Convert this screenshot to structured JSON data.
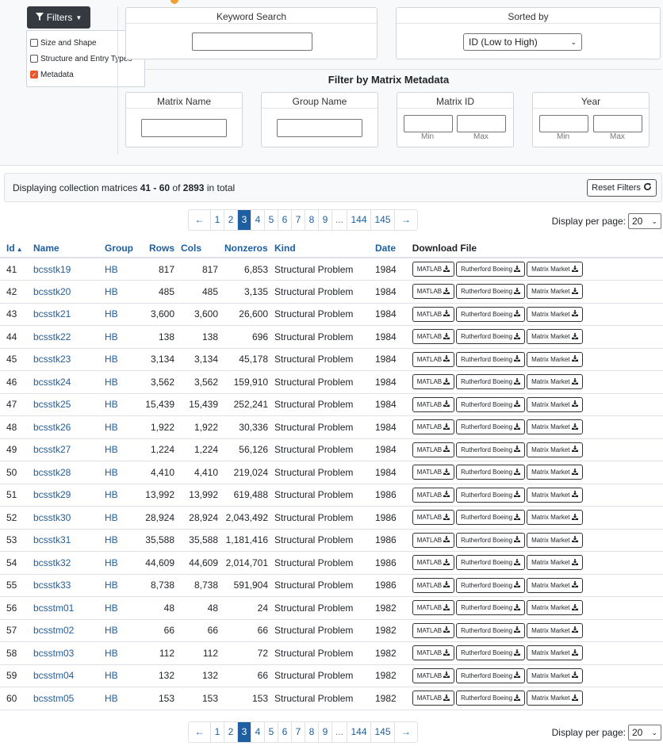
{
  "filters": {
    "button_label": "Filters",
    "menu": [
      {
        "label": "Size and Shape",
        "checked": false
      },
      {
        "label": "Structure and Entry Types",
        "checked": false
      },
      {
        "label": "Metadata",
        "checked": true
      }
    ]
  },
  "keyword_search": {
    "title": "Keyword Search",
    "value": ""
  },
  "sorted_by": {
    "title": "Sorted by",
    "selected": "ID (Low to High)"
  },
  "metadata_filter": {
    "title": "Filter by Matrix Metadata",
    "matrix_name": {
      "title": "Matrix Name",
      "value": ""
    },
    "group_name": {
      "title": "Group Name",
      "value": ""
    },
    "matrix_id": {
      "title": "Matrix ID",
      "min_label": "Min",
      "max_label": "Max"
    },
    "year": {
      "title": "Year",
      "min_label": "Min",
      "max_label": "Max"
    }
  },
  "display": {
    "prefix": "Displaying collection matrices ",
    "range": "41 - 60",
    "middle": " of ",
    "total": "2893",
    "suffix": " in total",
    "reset_label": "Reset Filters"
  },
  "pagination": {
    "pages": [
      "←",
      "1",
      "2",
      "3",
      "4",
      "5",
      "6",
      "7",
      "8",
      "9",
      "...",
      "144",
      "145",
      "→"
    ],
    "active": "3",
    "per_page_label": "Display per page:",
    "per_page": "20"
  },
  "table": {
    "headers": [
      "Id",
      "Name",
      "Group",
      "Rows",
      "Cols",
      "Nonzeros",
      "Kind",
      "Date",
      "Download File"
    ],
    "sort_indicator": "▲",
    "download_labels": [
      "MATLAB",
      "Rutherford Boeing",
      "Matrix Market"
    ],
    "rows": [
      [
        "41",
        "bcsstk19",
        "HB",
        "817",
        "817",
        "6,853",
        "Structural Problem",
        "1984"
      ],
      [
        "42",
        "bcsstk20",
        "HB",
        "485",
        "485",
        "3,135",
        "Structural Problem",
        "1984"
      ],
      [
        "43",
        "bcsstk21",
        "HB",
        "3,600",
        "3,600",
        "26,600",
        "Structural Problem",
        "1984"
      ],
      [
        "44",
        "bcsstk22",
        "HB",
        "138",
        "138",
        "696",
        "Structural Problem",
        "1984"
      ],
      [
        "45",
        "bcsstk23",
        "HB",
        "3,134",
        "3,134",
        "45,178",
        "Structural Problem",
        "1984"
      ],
      [
        "46",
        "bcsstk24",
        "HB",
        "3,562",
        "3,562",
        "159,910",
        "Structural Problem",
        "1984"
      ],
      [
        "47",
        "bcsstk25",
        "HB",
        "15,439",
        "15,439",
        "252,241",
        "Structural Problem",
        "1984"
      ],
      [
        "48",
        "bcsstk26",
        "HB",
        "1,922",
        "1,922",
        "30,336",
        "Structural Problem",
        "1984"
      ],
      [
        "49",
        "bcsstk27",
        "HB",
        "1,224",
        "1,224",
        "56,126",
        "Structural Problem",
        "1984"
      ],
      [
        "50",
        "bcsstk28",
        "HB",
        "4,410",
        "4,410",
        "219,024",
        "Structural Problem",
        "1984"
      ],
      [
        "51",
        "bcsstk29",
        "HB",
        "13,992",
        "13,992",
        "619,488",
        "Structural Problem",
        "1986"
      ],
      [
        "52",
        "bcsstk30",
        "HB",
        "28,924",
        "28,924",
        "2,043,492",
        "Structural Problem",
        "1986"
      ],
      [
        "53",
        "bcsstk31",
        "HB",
        "35,588",
        "35,588",
        "1,181,416",
        "Structural Problem",
        "1986"
      ],
      [
        "54",
        "bcsstk32",
        "HB",
        "44,609",
        "44,609",
        "2,014,701",
        "Structural Problem",
        "1986"
      ],
      [
        "55",
        "bcsstk33",
        "HB",
        "8,738",
        "8,738",
        "591,904",
        "Structural Problem",
        "1986"
      ],
      [
        "56",
        "bcsstm01",
        "HB",
        "48",
        "48",
        "24",
        "Structural Problem",
        "1982"
      ],
      [
        "57",
        "bcsstm02",
        "HB",
        "66",
        "66",
        "66",
        "Structural Problem",
        "1982"
      ],
      [
        "58",
        "bcsstm03",
        "HB",
        "112",
        "112",
        "72",
        "Structural Problem",
        "1982"
      ],
      [
        "59",
        "bcsstm04",
        "HB",
        "132",
        "132",
        "66",
        "Structural Problem",
        "1982"
      ],
      [
        "60",
        "bcsstm05",
        "HB",
        "153",
        "153",
        "153",
        "Structural Problem",
        "1982"
      ]
    ]
  },
  "colors": {
    "link": "#1d5fa0",
    "accent": "#e8562a",
    "dark_button": "#343a40"
  }
}
